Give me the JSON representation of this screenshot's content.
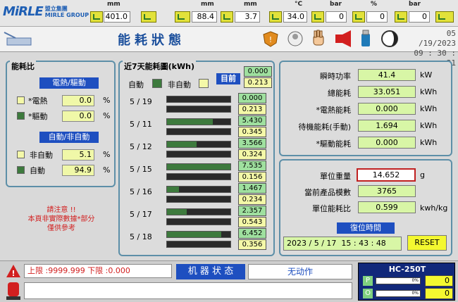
{
  "top": {
    "logo_text": "MiRLE",
    "logo_cn": "盟立集團",
    "logo_sub": "MIRLE GROUP",
    "fields": [
      {
        "unit": "mm",
        "value": "401.0"
      },
      {
        "unit": "mm",
        "value": "88.4"
      },
      {
        "unit": "mm",
        "value": "3.7"
      },
      {
        "unit": "°C",
        "value": "34.0"
      },
      {
        "unit": "bar",
        "value": "0"
      },
      {
        "unit": "%",
        "value": "0"
      },
      {
        "unit": "bar",
        "value": "0"
      }
    ]
  },
  "titlebar": {
    "title": "能耗狀態",
    "date": "05 /19/2023",
    "time": "09 : 30 : 21"
  },
  "ratio": {
    "title": "能耗比",
    "group1_header": "電熱/驅動",
    "group1": [
      {
        "label": "*電熱",
        "value": "0.0",
        "unit": "%"
      },
      {
        "label": "*驅動",
        "value": "0.0",
        "unit": "%"
      }
    ],
    "group2_header": "自動/非自動",
    "group2": [
      {
        "label": "非自動",
        "value": "5.1",
        "unit": "%"
      },
      {
        "label": "自動",
        "value": "94.9",
        "unit": "%"
      }
    ],
    "notice": "請注意 !!\n本頁非實際數據*部分\n僅供參考"
  },
  "weekly": {
    "title": "近7天能耗圖(kWh)",
    "legend_auto": "自動",
    "legend_manual": "非自動",
    "current_label": "目前",
    "current_auto": "0.000",
    "current_manual": "0.213",
    "days": [
      {
        "date": "5 / 19",
        "auto": "0.000",
        "manual": "0.213",
        "fill": 0.0
      },
      {
        "date": "5 / 11",
        "auto": "5.430",
        "manual": "0.345",
        "fill": 0.72
      },
      {
        "date": "5 / 12",
        "auto": "3.566",
        "manual": "0.324",
        "fill": 0.47
      },
      {
        "date": "5 / 15",
        "auto": "7.535",
        "manual": "0.156",
        "fill": 1.0
      },
      {
        "date": "5 / 16",
        "auto": "1.467",
        "manual": "0.234",
        "fill": 0.19
      },
      {
        "date": "5 / 17",
        "auto": "2.357",
        "manual": "0.543",
        "fill": 0.31
      },
      {
        "date": "5 / 18",
        "auto": "6.452",
        "manual": "0.356",
        "fill": 0.86
      }
    ]
  },
  "power": {
    "rows": [
      {
        "label": "瞬時功率",
        "value": "41.4",
        "unit": "kW"
      },
      {
        "label": "總能耗",
        "value": "33.051",
        "unit": "kWh"
      },
      {
        "label": "*電熱能耗",
        "value": "0.000",
        "unit": "kWh"
      },
      {
        "label": "待機能耗(手動)",
        "value": "1.694",
        "unit": "kWh"
      },
      {
        "label": "*驅動能耗",
        "value": "0.000",
        "unit": "kWh"
      }
    ]
  },
  "unit_panel": {
    "weight_label": "單位重量",
    "weight_value": "14.652",
    "weight_unit": "g",
    "count_label": "當前產品模數",
    "count_value": "3765",
    "ratio_label": "單位能耗比",
    "ratio_value": "0.599",
    "ratio_unit": "kwh/kg",
    "reset_time_header": "復位時間",
    "reset_year": "2023",
    "reset_month": "5",
    "reset_day": "17",
    "reset_hour": "15",
    "reset_min": "43",
    "reset_sec": "48",
    "reset_button": "RESET"
  },
  "bottom": {
    "limit_text": "上限 :9999.999  下限 :0.000",
    "machine_status_label": "机 器 状 态",
    "machine_status_value": "无动作",
    "model": "HC-250T",
    "p_label": "P",
    "o_label": "O",
    "p_pct": "0%",
    "o_pct": "0%",
    "p_value": "0",
    "o_value": "0"
  },
  "colors": {
    "accent_blue": "#1e4fc0",
    "auto_green": "#3d7a3d",
    "manual_yellow": "#f4f8a8",
    "alarm_red": "#d21f1f"
  }
}
